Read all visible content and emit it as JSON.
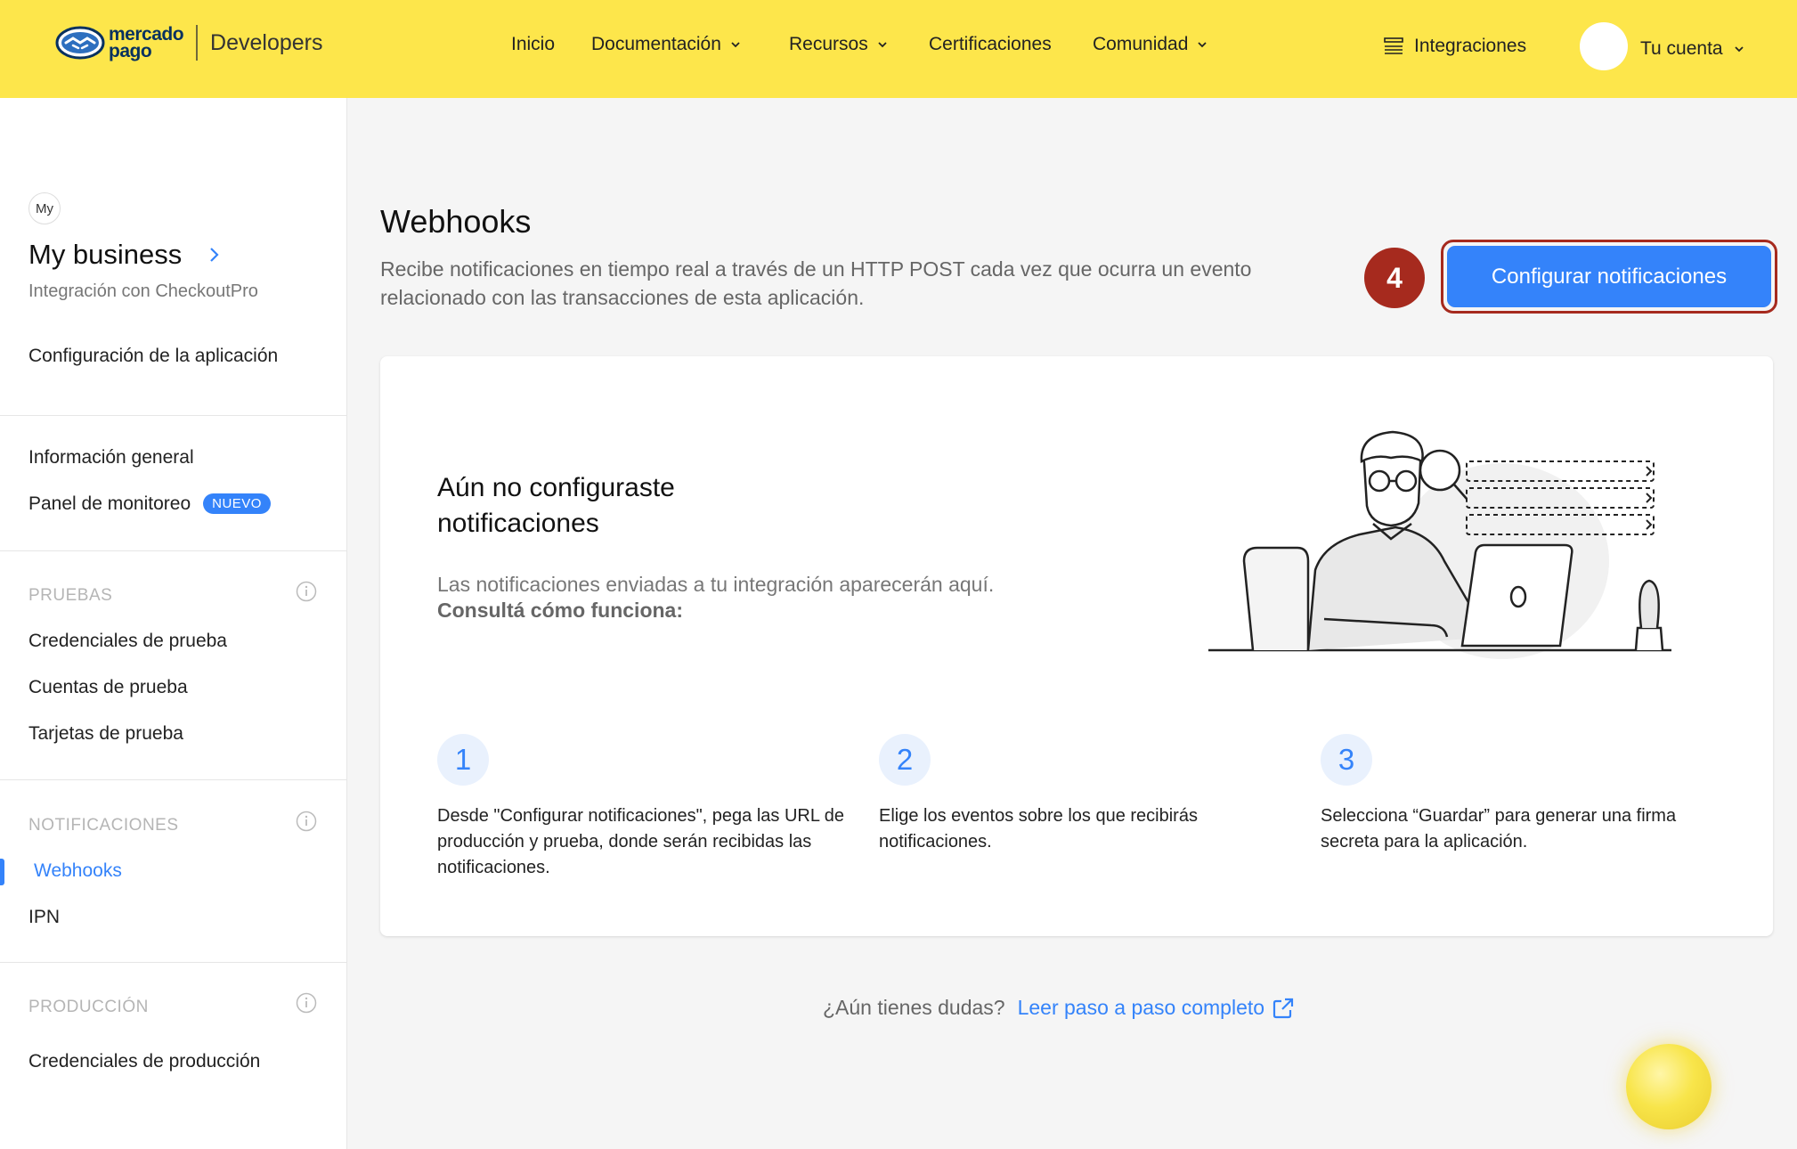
{
  "header": {
    "logo_text_1": "mercado",
    "logo_text_2": "pago",
    "product": "Developers",
    "nav": [
      {
        "label": "Inicio"
      },
      {
        "label": "Documentación"
      },
      {
        "label": "Recursos"
      },
      {
        "label": "Certificaciones"
      },
      {
        "label": "Comunidad"
      }
    ],
    "integrations": "Integraciones",
    "account": "Tu cuenta"
  },
  "sidebar": {
    "badge": "My",
    "business_name": "My business",
    "business_sub": "Integración con CheckoutPro",
    "app_config": "Configuración de la aplicación",
    "general_info": "Información general",
    "monitor_panel": "Panel de monitoreo",
    "new_badge": "NUEVO",
    "section_tests": "PRUEBAS",
    "test_credentials": "Credenciales de prueba",
    "test_accounts": "Cuentas de prueba",
    "test_cards": "Tarjetas de prueba",
    "section_notifications": "NOTIFICACIONES",
    "webhooks": "Webhooks",
    "ipn": "IPN",
    "section_production": "PRODUCCIÓN",
    "prod_credentials": "Credenciales de producción"
  },
  "main": {
    "title": "Webhooks",
    "description": "Recibe notificaciones en tiempo real a través de un HTTP POST cada vez que ocurra un evento relacionado con las transacciones de esta aplicación.",
    "step_badge": "4",
    "configure_button": "Configurar notificaciones",
    "empty_title": "Aún no configuraste notificaciones",
    "empty_desc": "Las notificaciones enviadas a tu integración aparecerán aquí.",
    "empty_link": "Consultá cómo funciona:",
    "steps": [
      {
        "num": "1",
        "text": "Desde \"Configurar notificaciones\", pega las URL de producción y prueba, donde serán recibidas las notificaciones."
      },
      {
        "num": "2",
        "text": "Elige los eventos sobre los que recibirás notificaciones."
      },
      {
        "num": "3",
        "text": "Selecciona “Guardar” para generar una firma secreta para la aplicación."
      }
    ],
    "footer_question": "¿Aún tienes dudas?",
    "footer_link": "Leer paso a paso completo"
  },
  "colors": {
    "header_bg": "#fde64b",
    "accent": "#3483fa",
    "highlight": "#a62a1e"
  }
}
